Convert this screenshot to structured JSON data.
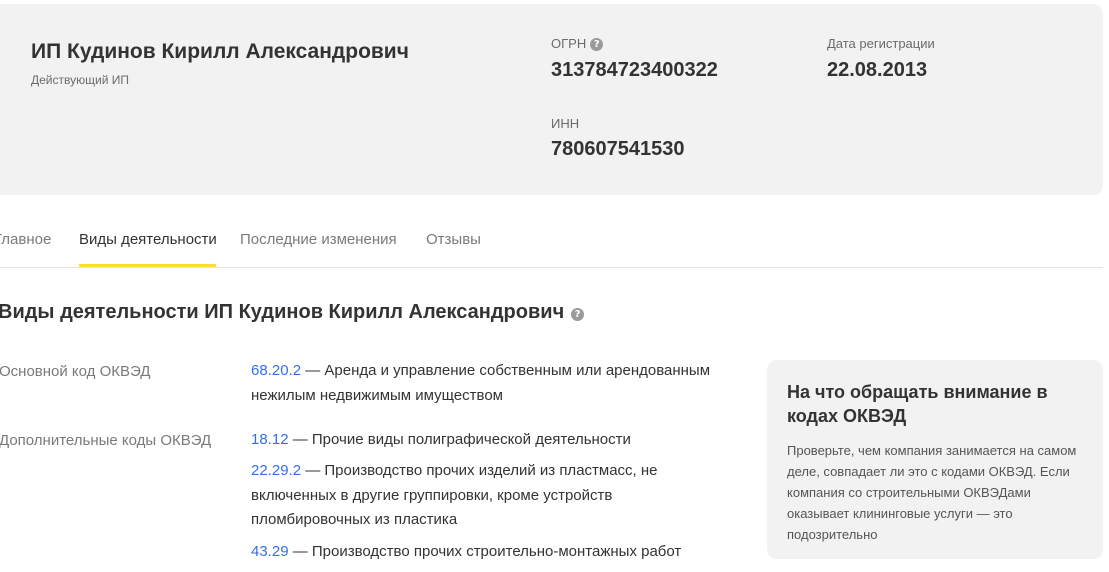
{
  "company": {
    "name": "ИП Кудинов Кирилл Александрович",
    "status": "Действующий ИП"
  },
  "ogrn": {
    "label": "ОГРН",
    "value": "313784723400322"
  },
  "registration": {
    "label": "Дата регистрации",
    "value": "22.08.2013"
  },
  "inn": {
    "label": "ИНН",
    "value": "780607541530"
  },
  "help_glyph": "?",
  "tabs": [
    {
      "label": "Главное"
    },
    {
      "label": "Виды деятельности",
      "active": true
    },
    {
      "label": "Последние изменения"
    },
    {
      "label": "Отзывы"
    }
  ],
  "section_title": "Виды деятельности ИП Кудинов Кирилл Александрович",
  "okved": {
    "main_label": "Основной код ОКВЭД",
    "additional_label": "Дополнительные коды ОКВЭД",
    "main": {
      "code": "68.20.2",
      "text": " — Аренда и управление собственным или арендованным нежилым недвижимым имуществом"
    },
    "additional": [
      {
        "code": "18.12",
        "text": " — Прочие виды полиграфической деятельности"
      },
      {
        "code": "22.29.2",
        "text": " — Производство прочих изделий из пластмасс, не включенных в другие группировки, кроме устройств пломбировочных из пластика"
      },
      {
        "code": "43.29",
        "text": " — Производство прочих строительно-монтажных работ"
      }
    ]
  },
  "aside": {
    "title": "На что обращать внимание в кодах ОКВЭД",
    "text": "Проверьте, чем компания занимается на самом деле, совпадает ли это с кодами ОКВЭД. Если компания со строительными ОКВЭДами оказывает клининговые услуги — это подозрительно"
  },
  "colors": {
    "link": "#336fee",
    "tab_underline": "#ffdd2d",
    "card_background": "#f2f2f2"
  }
}
